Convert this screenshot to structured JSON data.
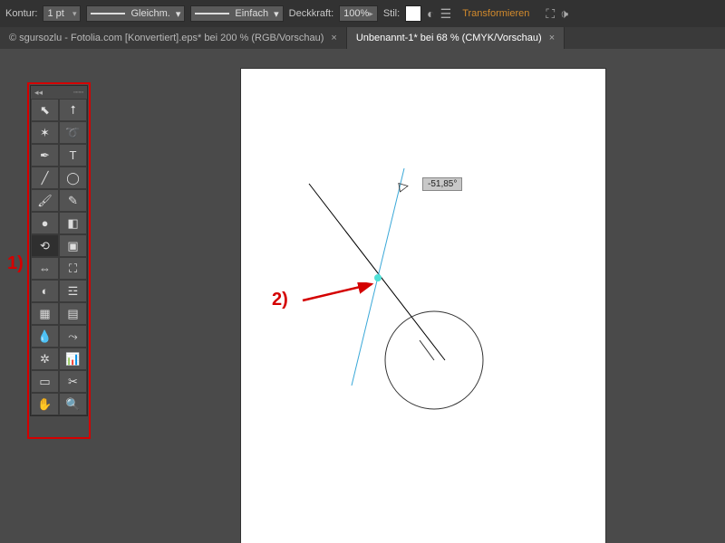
{
  "topbar": {
    "kontur_label": "Kontur:",
    "stroke_weight": "1 pt",
    "preset1": "Gleichm.",
    "preset2": "Einfach",
    "deckkraft_label": "Deckkraft:",
    "opacity": "100%",
    "stil_label": "Stil:",
    "transform_label": "Transformieren"
  },
  "tabs": {
    "a": "© sgursozlu - Fotolia.com [Konvertiert].eps* bei 200 % (RGB/Vorschau)",
    "b": "Unbenannt-1* bei 68 % (CMYK/Vorschau)",
    "close": "×"
  },
  "annotations": {
    "one": "1)",
    "two": "2)"
  },
  "tooltip": "-51,85°",
  "tool_names": [
    "selection-tool",
    "direct-selection-tool",
    "magic-wand-tool",
    "lasso-tool",
    "pen-tool",
    "type-tool",
    "line-tool",
    "ellipse-tool",
    "paintbrush-tool",
    "pencil-tool",
    "blob-brush-tool",
    "eraser-tool",
    "rotate-tool",
    "scale-tool",
    "width-tool",
    "free-transform-tool",
    "shape-builder-tool",
    "perspective-grid-tool",
    "mesh-tool",
    "gradient-tool",
    "eyedropper-tool",
    "blend-tool",
    "symbol-sprayer-tool",
    "column-graph-tool",
    "artboard-tool",
    "slice-tool",
    "hand-tool",
    "zoom-tool"
  ],
  "chart_data": {
    "type": "none"
  }
}
